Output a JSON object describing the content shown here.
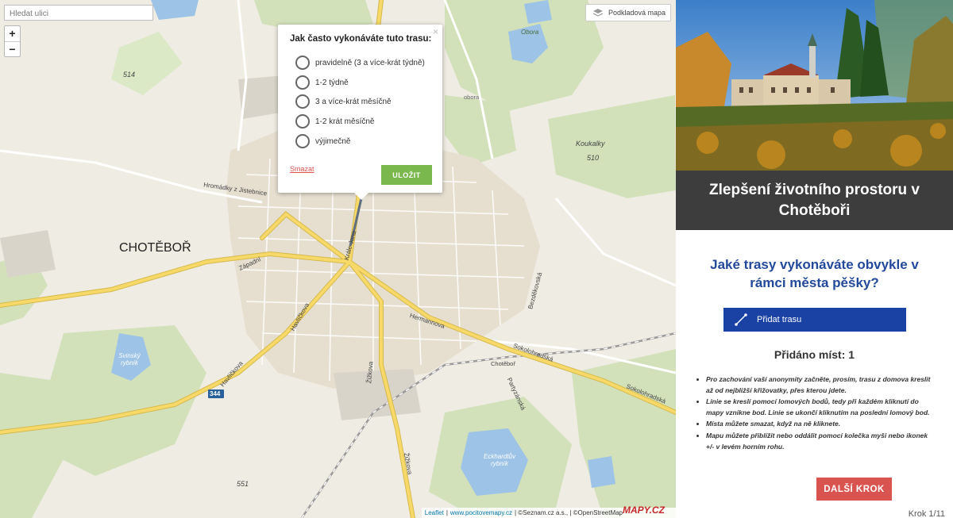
{
  "map": {
    "search_placeholder": "Hledat ulici",
    "zoom_in": "+",
    "zoom_out": "−",
    "layer_button": "Podkladová mapa",
    "labels": {
      "town": "CHOTĚBOŘ",
      "hromadky": "Hromádky z Jistebnice",
      "zapadni": "Západní",
      "krale_jana": "Krále Jana",
      "havlickova1": "Havlíčkova",
      "havlickova2": "Havlíčkova",
      "hermannova": "Hermannova",
      "sokolohradska1": "Sokolohradská",
      "sokolohradska2": "Sokolohradská",
      "zizkova1": "Žižkova",
      "zizkova2": "Žižkova",
      "bezdekovska": "Bezděkovská",
      "partyzanska": "Partyzánská",
      "chotebor_stn": "Chotěboř",
      "obora1": "Obora",
      "obora2": "obora",
      "koukalky": "Koukalky",
      "h510": "510",
      "h514": "514",
      "h551": "551",
      "svinsky": "Svinský rybník",
      "eckhardtuv": "Eckhardtův rybník",
      "road344": "344"
    },
    "attribution": {
      "leaflet": "Leaflet",
      "site": "www.pocitovemapy.cz",
      "rest": "| ©Seznam.cz a.s., | ©OpenStreetMap"
    },
    "logo": "MAPY.CZ"
  },
  "popup": {
    "title": "Jak často vykonáváte tuto trasu:",
    "close": "×",
    "options": [
      "pravidelně (3 a více-krát týdně)",
      "1-2 týdně",
      "3 a více-krát měsíčně",
      "1-2 krát měsíčně",
      "výjimečně"
    ],
    "delete_label": "Smazat",
    "save_label": "ULOŽIT"
  },
  "sidebar": {
    "title": "Zlepšení životního prostoru v Chotěboři",
    "question": "Jaké trasy vykonáváte obvykle v rámci města pěšky?",
    "add_route": "Přidat trasu",
    "count_text": "Přidáno míst: 1",
    "instructions": [
      "Pro zachování vaší anonymity začněte, prosím, trasu z domova kreslit až od nejbližší křižovatky, přes kterou jdete.",
      "Linie se kreslí pomocí lomových bodů, tedy při každém kliknutí do mapy vznikne bod. Linie se ukončí kliknutím na poslední lomový bod.",
      "Místa můžete smazat, když na ně kliknete.",
      "Mapu můžete přiblížit nebo oddálit pomocí kolečka myši nebo ikonek +/- v levém horním rohu."
    ],
    "next_label": "DALŠÍ KROK",
    "step_label": "Krok 1/11"
  },
  "colors": {
    "title_band": "#3d3d3d",
    "question": "#23499a",
    "add_route_button": "#1a41a4",
    "next_button": "#d9534f",
    "save_button": "#7ab84d",
    "road_yellow": "#f6d968",
    "forest": "#c8dcae",
    "water": "#9dc3e6",
    "route": "#6a7a8a"
  }
}
